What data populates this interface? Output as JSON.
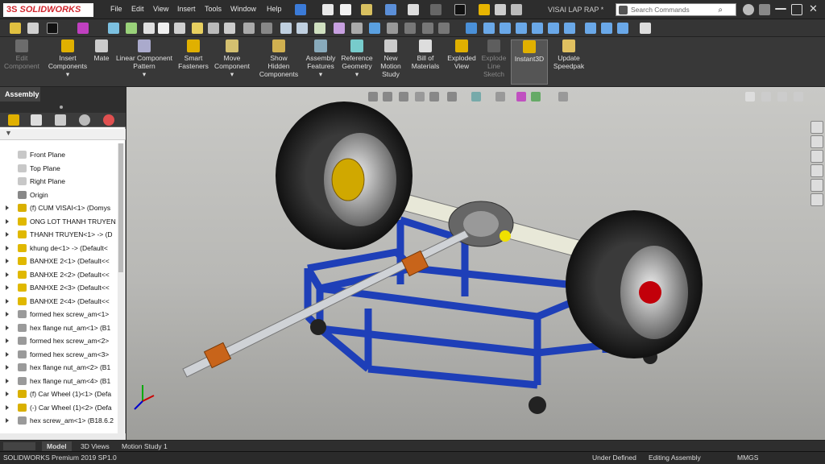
{
  "app": {
    "logo_text": "SOLIDWORKS",
    "logo_prefix": "3S",
    "document_title": "VISAI LAP RAP *"
  },
  "menu": {
    "items": [
      "File",
      "Edit",
      "View",
      "Insert",
      "Tools",
      "Window",
      "Help"
    ]
  },
  "search": {
    "placeholder": "Search Commands"
  },
  "command_manager": {
    "commands": [
      {
        "label1": "Edit",
        "label2": "Component",
        "icon": "edit-component-icon",
        "enabled": false
      },
      {
        "label1": "Insert",
        "label2": "Components",
        "icon": "insert-components-icon",
        "enabled": true
      },
      {
        "label1": "Mate",
        "label2": "",
        "icon": "mate-icon",
        "enabled": true
      },
      {
        "label1": "Linear Component",
        "label2": "Pattern",
        "icon": "linear-pattern-icon",
        "enabled": true
      },
      {
        "label1": "Smart",
        "label2": "Fasteners",
        "icon": "smart-fasteners-icon",
        "enabled": true
      },
      {
        "label1": "Move",
        "label2": "Component",
        "icon": "move-component-icon",
        "enabled": true
      },
      {
        "label1": "Show",
        "label2": "Hidden",
        "label3": "Components",
        "icon": "show-hidden-icon",
        "enabled": true
      },
      {
        "label1": "Assembly",
        "label2": "Features",
        "icon": "assembly-features-icon",
        "enabled": true
      },
      {
        "label1": "Reference",
        "label2": "Geometry",
        "icon": "reference-geometry-icon",
        "enabled": true
      },
      {
        "label1": "New",
        "label2": "Motion",
        "label3": "Study",
        "icon": "motion-study-icon",
        "enabled": true
      },
      {
        "label1": "Bill of",
        "label2": "Materials",
        "icon": "bom-icon",
        "enabled": true
      },
      {
        "label1": "Exploded",
        "label2": "View",
        "icon": "exploded-view-icon",
        "enabled": true
      },
      {
        "label1": "Explode",
        "label2": "Line",
        "label3": "Sketch",
        "icon": "explode-line-icon",
        "enabled": false
      },
      {
        "label1": "Instant3D",
        "label2": "",
        "icon": "instant3d-icon",
        "enabled": true,
        "active": true
      },
      {
        "label1": "Update",
        "label2": "Speedpak",
        "icon": "speedpak-icon",
        "enabled": true
      }
    ]
  },
  "panel": {
    "tab": "Assembly"
  },
  "feature_tree": {
    "items": [
      {
        "label": "Front Plane",
        "icon": "plane-icon",
        "expandable": false
      },
      {
        "label": "Top Plane",
        "icon": "plane-icon",
        "expandable": false
      },
      {
        "label": "Right Plane",
        "icon": "plane-icon",
        "expandable": false
      },
      {
        "label": "Origin",
        "icon": "origin-icon",
        "expandable": false
      },
      {
        "label": "(f) CUM VISAI<1> (Domys",
        "icon": "subassembly-icon",
        "expandable": true
      },
      {
        "label": "ONG LOT THANH TRUYEN",
        "icon": "part-icon",
        "expandable": true
      },
      {
        "label": "THANH TRUYEN<1> -> (D",
        "icon": "part-icon",
        "expandable": true
      },
      {
        "label": "khung de<1> -> (Default<",
        "icon": "part-icon",
        "expandable": true
      },
      {
        "label": "BANHXE 2<1> (Default<<",
        "icon": "part-icon",
        "expandable": true
      },
      {
        "label": "BANHXE 2<2> (Default<<",
        "icon": "part-icon",
        "expandable": true
      },
      {
        "label": "BANHXE 2<3> (Default<<",
        "icon": "part-icon",
        "expandable": true
      },
      {
        "label": "BANHXE 2<4> (Default<<",
        "icon": "part-icon",
        "expandable": true
      },
      {
        "label": "formed hex screw_am<1>",
        "icon": "fastener-icon",
        "expandable": true
      },
      {
        "label": "hex flange nut_am<1> (B1",
        "icon": "fastener-icon",
        "expandable": true
      },
      {
        "label": "formed hex screw_am<2>",
        "icon": "fastener-icon",
        "expandable": true
      },
      {
        "label": "formed hex screw_am<3>",
        "icon": "fastener-icon",
        "expandable": true
      },
      {
        "label": "hex flange nut_am<2> (B1",
        "icon": "fastener-icon",
        "expandable": true
      },
      {
        "label": "hex flange nut_am<4> (B1",
        "icon": "fastener-icon",
        "expandable": true
      },
      {
        "label": "(f) Car Wheel (1)<1> (Defa",
        "icon": "subassembly-icon",
        "expandable": true
      },
      {
        "label": "(-) Car Wheel (1)<2> (Defa",
        "icon": "subassembly-icon",
        "expandable": true
      },
      {
        "label": "hex screw_am<1> (B18.6.2",
        "icon": "fastener-icon",
        "expandable": true
      }
    ]
  },
  "bottom_tabs": [
    "Model",
    "3D Views",
    "Motion Study 1"
  ],
  "status": {
    "product": "SOLIDWORKS Premium 2019 SP1.0",
    "definition": "Under Defined",
    "mode": "Editing Assembly",
    "units": "MMGS"
  },
  "colors": {
    "frame": "#2a4fd6",
    "brand": "#d1262e",
    "background": "#2b2b2b"
  }
}
